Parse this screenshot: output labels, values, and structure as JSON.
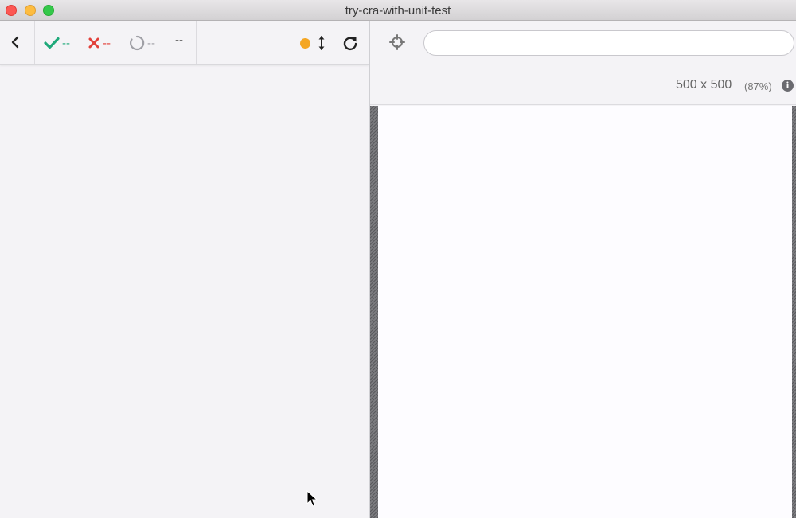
{
  "window": {
    "title": "try-cra-with-unit-test"
  },
  "reporter": {
    "stats": {
      "passed": "--",
      "failed": "--",
      "pending": "--"
    },
    "duration": "--"
  },
  "app": {
    "url_input": {
      "value": ""
    },
    "viewport": {
      "size": "500 x 500",
      "scale": "(87%)"
    }
  },
  "colors": {
    "passed": "#1fa97a",
    "failed": "#e2413b",
    "pending": "#a0a0a6",
    "indicator": "#f4a623"
  },
  "icons": {
    "back": "chevron-left-icon",
    "passed": "check-icon",
    "failed": "x-icon",
    "pending": "circle-notch-icon",
    "scroll": "arrows-vertical-icon",
    "restart": "redo-icon",
    "selector": "crosshairs-icon",
    "info": "info-circle-icon"
  }
}
